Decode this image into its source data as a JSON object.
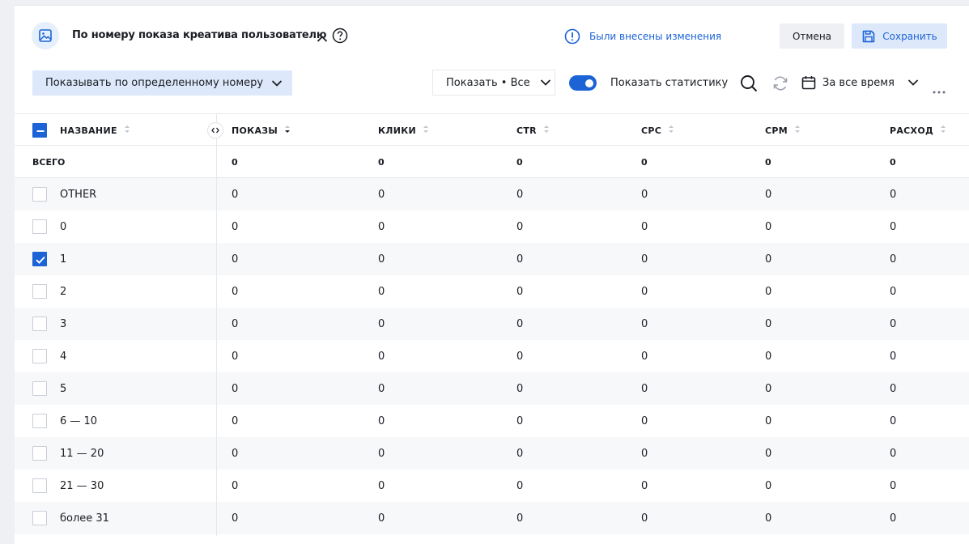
{
  "header": {
    "title": "По номеру показа креатива пользователю",
    "changes_notice": "Были внесены изменения",
    "cancel_label": "Отмена",
    "save_label": "Сохранить"
  },
  "toolbar": {
    "mode_select": "Показывать по определенному номеру",
    "show_select": "Показать • Все",
    "stats_toggle_label": "Показать статистику",
    "stats_toggle_on": true,
    "date_range": "За все время"
  },
  "table": {
    "name_header": "НАЗВАНИЕ",
    "columns": [
      "ПОКАЗЫ",
      "КЛИКИ",
      "CTR",
      "CPC",
      "CPM",
      "РАСХОД"
    ],
    "sorted_column": "ПОКАЗЫ",
    "total": {
      "label": "ВСЕГО",
      "values": [
        "0",
        "0",
        "0",
        "0",
        "0",
        "0"
      ]
    },
    "rows": [
      {
        "name": "OTHER",
        "checked": false,
        "values": [
          "0",
          "0",
          "0",
          "0",
          "0",
          "0"
        ]
      },
      {
        "name": "0",
        "checked": false,
        "values": [
          "0",
          "0",
          "0",
          "0",
          "0",
          "0"
        ]
      },
      {
        "name": "1",
        "checked": true,
        "values": [
          "0",
          "0",
          "0",
          "0",
          "0",
          "0"
        ]
      },
      {
        "name": "2",
        "checked": false,
        "values": [
          "0",
          "0",
          "0",
          "0",
          "0",
          "0"
        ]
      },
      {
        "name": "3",
        "checked": false,
        "values": [
          "0",
          "0",
          "0",
          "0",
          "0",
          "0"
        ]
      },
      {
        "name": "4",
        "checked": false,
        "values": [
          "0",
          "0",
          "0",
          "0",
          "0",
          "0"
        ]
      },
      {
        "name": "5",
        "checked": false,
        "values": [
          "0",
          "0",
          "0",
          "0",
          "0",
          "0"
        ]
      },
      {
        "name": "6 — 10",
        "checked": false,
        "values": [
          "0",
          "0",
          "0",
          "0",
          "0",
          "0"
        ]
      },
      {
        "name": "11 — 20",
        "checked": false,
        "values": [
          "0",
          "0",
          "0",
          "0",
          "0",
          "0"
        ]
      },
      {
        "name": "21 — 30",
        "checked": false,
        "values": [
          "0",
          "0",
          "0",
          "0",
          "0",
          "0"
        ]
      },
      {
        "name": "более 31",
        "checked": false,
        "values": [
          "0",
          "0",
          "0",
          "0",
          "0",
          "0"
        ]
      }
    ]
  },
  "colors": {
    "accent": "#1c63d6",
    "accent_light": "#dde9fb",
    "row_alt": "#f7f8fa",
    "border": "#e6e8ec"
  },
  "icons": {
    "title": "image-icon",
    "help": "question-circle-icon",
    "notice": "info-circle-icon",
    "save": "floppy-disk-icon",
    "search": "search-icon",
    "refresh": "refresh-icon",
    "calendar": "calendar-icon",
    "more": "more-horizontal-icon"
  }
}
